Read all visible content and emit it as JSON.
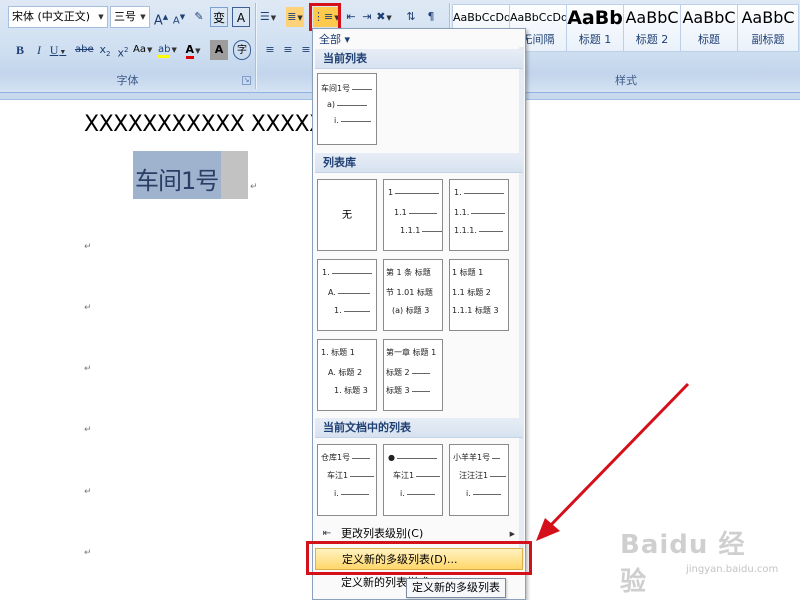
{
  "ribbon": {
    "font_group": {
      "label": "字体",
      "font_name": "宋体 (中文正文)",
      "font_size": "三号",
      "grow_font": "A",
      "shrink_font": "A",
      "phonetic": "变",
      "char_border": "A",
      "bold": "B",
      "italic": "I",
      "underline": "U",
      "strikethrough": "abe",
      "subscript": "x",
      "superscript": "x",
      "text_highlight": "ab",
      "font_color": "A",
      "char_shading": "A",
      "enclose": "字"
    },
    "paragraph_group": {
      "label": ""
    },
    "styles_group": {
      "label": "样式",
      "tiles": [
        {
          "preview": "AaBbCcDd",
          "name": ""
        },
        {
          "preview": "AaBbCcDd",
          "name": "无间隔"
        },
        {
          "preview": "AaBb",
          "name": "标题 1"
        },
        {
          "preview": "AaBbC",
          "name": "标题 2"
        },
        {
          "preview": "AaBbC",
          "name": "标题"
        },
        {
          "preview": "AaBbC",
          "name": "副标题"
        }
      ]
    }
  },
  "document": {
    "line1": "XXXXXXXXXXX XXXXXX",
    "heading": "车间1号",
    "para_mark": "↵"
  },
  "multilevel_menu": {
    "filter": "全部 ▾",
    "sections": {
      "current": "当前列表",
      "library": "列表库",
      "in_document": "当前文档中的列表"
    },
    "current_tile": {
      "l1": "车间1号",
      "l2": "a)",
      "l3": "i."
    },
    "library_tiles": {
      "none": "无",
      "num_a": [
        "1",
        "1.1",
        "1.1.1"
      ],
      "num_b": [
        "1.",
        "1.1.",
        "1.1.1."
      ],
      "roman": [
        "1.",
        "A.",
        "1."
      ],
      "article": [
        "第 1 条 标题",
        "节 1.01 标题",
        "(a) 标题 3"
      ],
      "heading_num": [
        "1 标题 1",
        "1.1 标题 2",
        "1.1.1 标题 3"
      ],
      "heading_alpha": [
        "1. 标题 1",
        "A. 标题 2",
        "1. 标题 3"
      ],
      "chapter": [
        "第一章 标题 1",
        "标题 2",
        "标题 3"
      ]
    },
    "doc_tiles": {
      "a": [
        "仓库1号",
        "车江1",
        "i."
      ],
      "b": [
        "●",
        "车江1",
        "i."
      ],
      "c": [
        "小羊羊1号",
        "汪汪汪1",
        "i."
      ]
    },
    "items": {
      "change_level": "更改列表级别(C)",
      "define_new_multilevel": "定义新的多级列表(D)...",
      "define_new_style": "定义新的列表样式"
    },
    "tooltip": "定义新的多级列表"
  },
  "annotation": {
    "accent": "#d4101b"
  },
  "watermark": {
    "main": "Baidu 经验",
    "sub": "jingyan.baidu.com"
  }
}
